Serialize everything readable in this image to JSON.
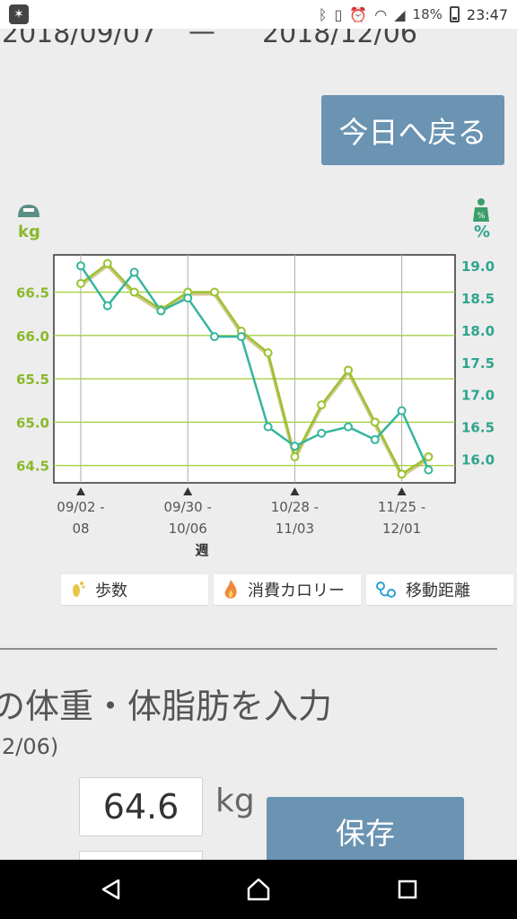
{
  "status_bar": {
    "battery": "18%",
    "time": "23:47"
  },
  "date_range": {
    "start": "2018/09/07",
    "separator": "—",
    "end": "2018/12/06"
  },
  "today_button": "今日へ戻る",
  "chart_data": {
    "type": "line",
    "x_label": "週",
    "categories": [
      "09/02 - 08",
      "",
      "",
      "",
      "09/30 - 10/06",
      "",
      "",
      "",
      "10/28 - 11/03",
      "",
      "",
      "",
      "11/25 - 12/01",
      ""
    ],
    "x_tick_labels": [
      {
        "index": 0,
        "line1": "09/02 -",
        "line2": "08"
      },
      {
        "index": 4,
        "line1": "09/30 -",
        "line2": "10/06"
      },
      {
        "index": 8,
        "line1": "10/28 -",
        "line2": "11/03"
      },
      {
        "index": 12,
        "line1": "11/25 -",
        "line2": "12/01"
      }
    ],
    "left_axis": {
      "unit": "kg",
      "ticks": [
        "66.5",
        "66.0",
        "65.5",
        "65.0",
        "64.5"
      ],
      "range": [
        64.3,
        66.93
      ],
      "color": "#8ab92c"
    },
    "right_axis": {
      "unit": "%",
      "ticks": [
        "19.0",
        "18.5",
        "18.0",
        "17.5",
        "17.0",
        "16.5",
        "16.0"
      ],
      "range": [
        15.63,
        19.17
      ],
      "color": "#2fa58f"
    },
    "series": [
      {
        "axis": "left",
        "color": "#9bc230",
        "values": [
          66.6,
          66.83,
          66.5,
          66.3,
          66.5,
          66.5,
          66.05,
          65.8,
          64.6,
          65.2,
          65.6,
          65.0,
          64.4,
          64.6
        ]
      },
      {
        "axis": "right",
        "color": "#36b59c",
        "values": [
          19.0,
          18.38,
          18.9,
          18.3,
          18.5,
          17.9,
          17.9,
          16.5,
          16.2,
          16.4,
          16.5,
          16.3,
          16.75,
          15.83
        ]
      }
    ],
    "grid": true
  },
  "legend_chips": [
    {
      "icon": "footprint-icon",
      "label": "歩数"
    },
    {
      "icon": "flame-icon",
      "label": "消費カロリー"
    },
    {
      "icon": "route-icon",
      "label": "移動距離"
    }
  ],
  "entry": {
    "title": "の体重・体脂肪を入力",
    "date": "2/06)",
    "weight_value": "64.6",
    "weight_unit": "kg",
    "save_label": "保存"
  }
}
